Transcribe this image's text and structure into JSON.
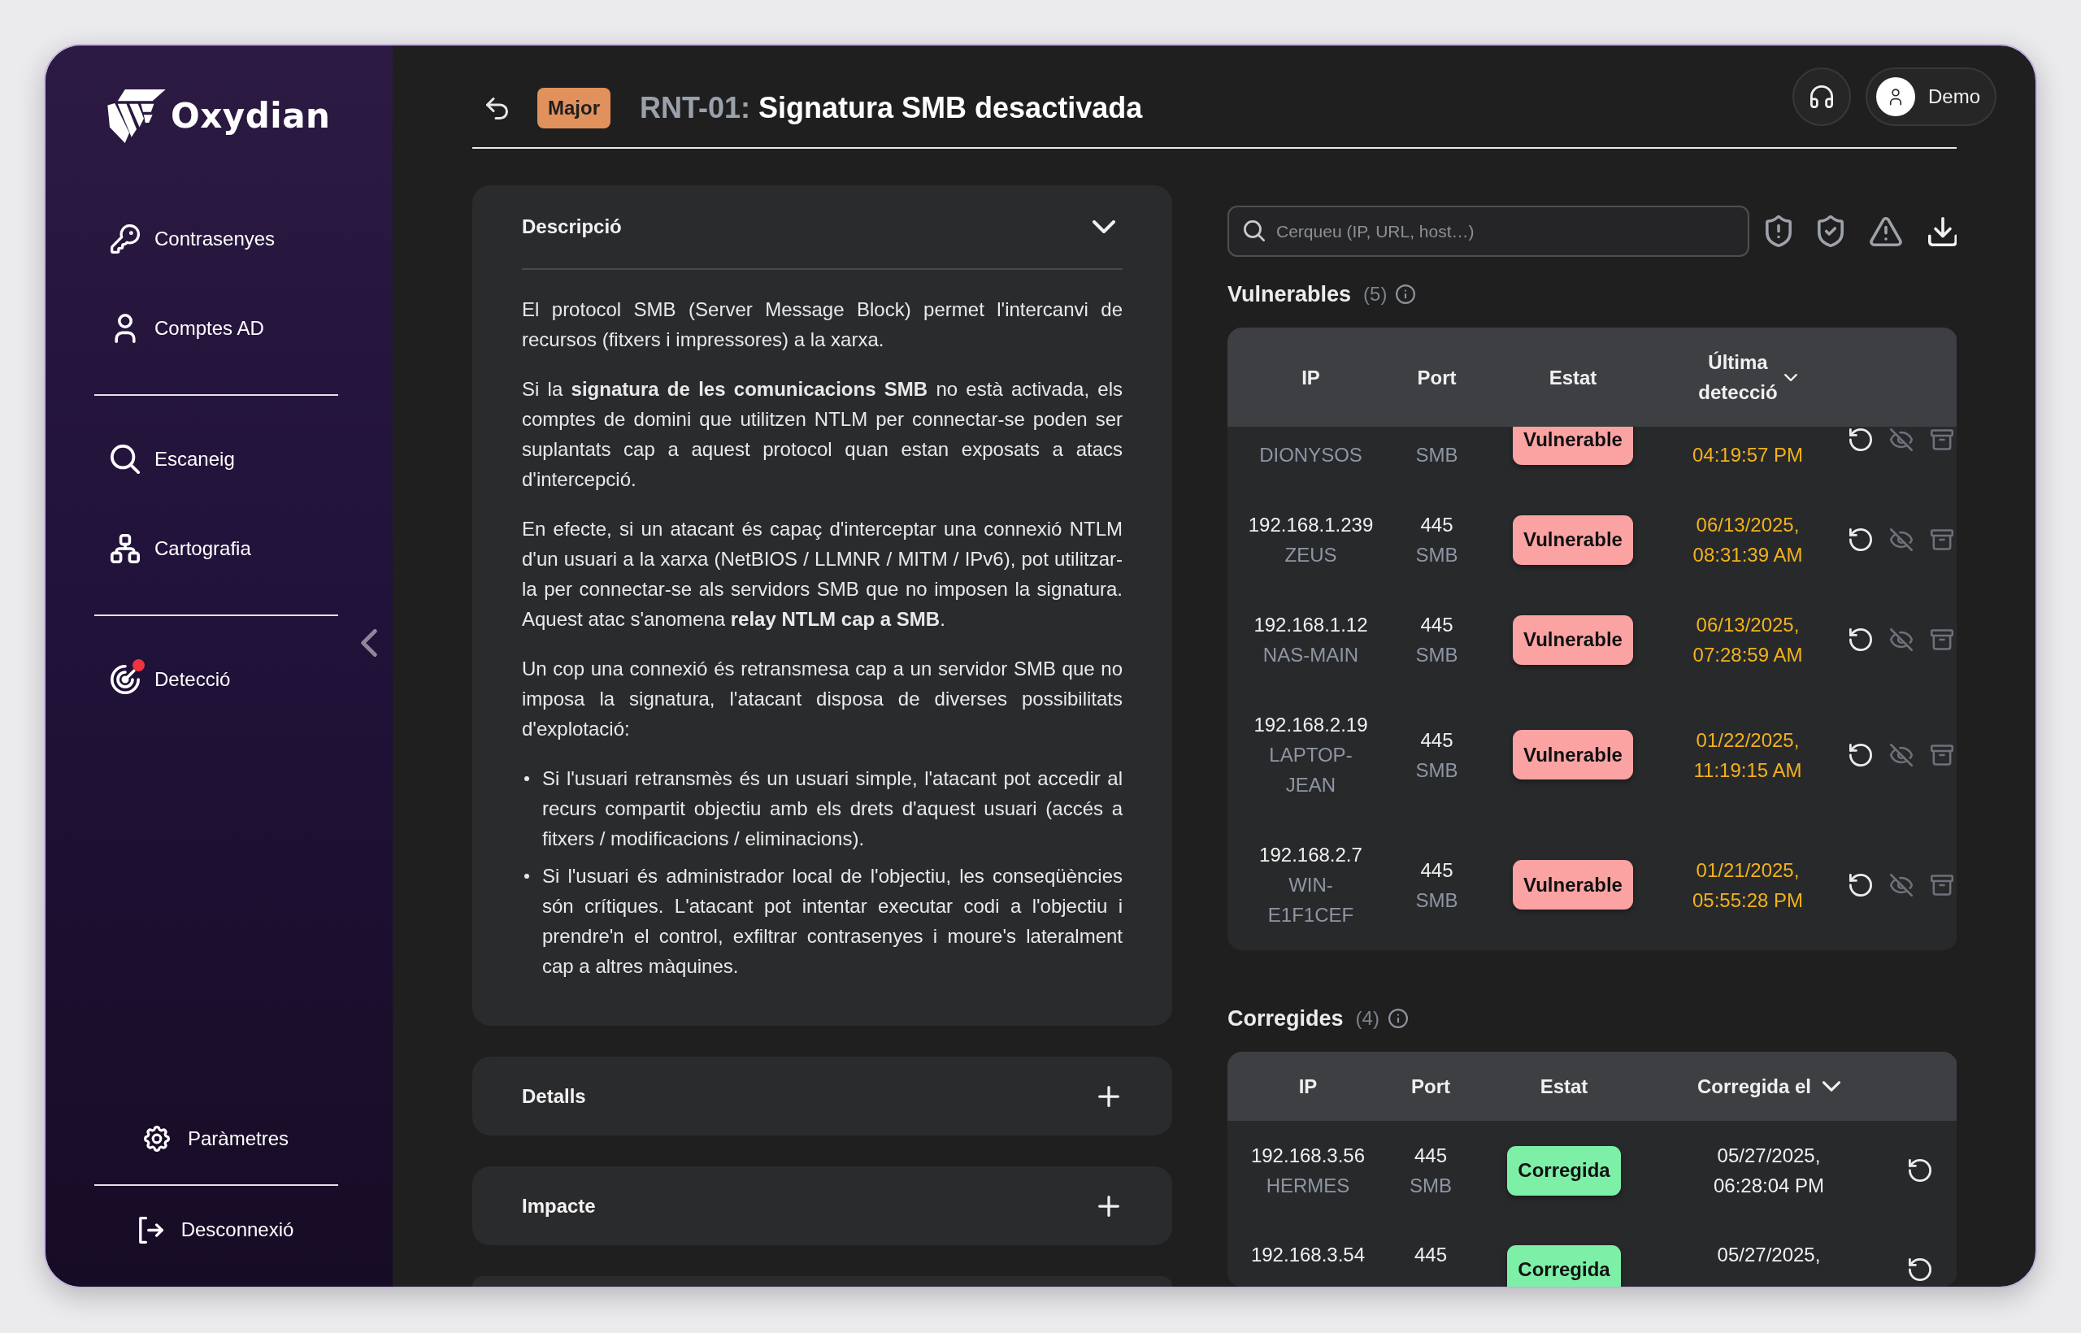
{
  "sidebar": {
    "logo": "Oxydian",
    "nav_groups": [
      {
        "items": [
          {
            "label": "Contrasenyes",
            "alert": false
          },
          {
            "label": "Comptes AD",
            "alert": false
          }
        ]
      },
      {
        "items": [
          {
            "label": "Escaneig",
            "alert": false
          },
          {
            "label": "Cartografia",
            "alert": false
          }
        ]
      },
      {
        "items": [
          {
            "label": "Detecció",
            "alert": true
          }
        ]
      }
    ],
    "footer_items": [
      {
        "label": "Paràmetres"
      },
      {
        "label": "Desconnexió"
      }
    ]
  },
  "header": {
    "severity": "Major",
    "code": "RNT-01:",
    "title": "Signatura SMB desactivada",
    "user": "Demo"
  },
  "sections": [
    {
      "title": "Descripció",
      "expanded": true,
      "paragraphs": [
        "El protocol SMB (Server Message Block) permet l'intercanvi de recursos (fitxers i impressores) a la xarxa.",
        "Si la **signatura de les comunicacions SMB** no està activada, els comptes de domini que utilitzen NTLM per connectar-se poden ser suplantats cap a aquest protocol quan estan exposats a atacs d'intercepció.",
        "En efecte, si un atacant és capaç d'interceptar una connexió NTLM d'un usuari a la xarxa (NetBIOS / LLMNR / MITM / IPv6), pot utilitzar-la per connectar-se als servidors SMB que no imposen la signatura. Aquest atac s'anomena **relay NTLM cap a SMB**.",
        "Un cop una connexió és retransmesa cap a un servidor SMB que no imposa la signatura, l'atacant disposa de diverses possibilitats d'explotació:"
      ],
      "list_items": [
        "Si l'usuari retransmès és un usuari simple, l'atacant pot accedir al recurs compartit objectiu amb els drets d'aquest usuari (accés a fitxers / modificacions / eliminacions).",
        "Si l'usuari és administrador local de l'objectiu, les conseqüències són crítiques. L'atacant pot intentar executar codi a l'objectiu i prendre'n el control, exfiltrar contrasenyes i moure's lateralment cap a altres màquines."
      ]
    },
    {
      "title": "Detalls",
      "expanded": false
    },
    {
      "title": "Impacte",
      "expanded": false
    }
  ],
  "search": {
    "placeholder": "Cerqueu (IP, URL, host…)"
  },
  "tables": [
    {
      "kind": "open",
      "title": "Vulnerables",
      "count": "(5)",
      "columns": [
        {
          "label": "IP",
          "sorted": false
        },
        {
          "label": "Port",
          "sorted": false
        },
        {
          "label": "Estat",
          "sorted": false
        },
        {
          "label": "Última detecció",
          "sorted": true
        }
      ],
      "rows": [
        {
          "host": "DIONYSOS",
          "protocol": "SMB",
          "status": "Vulnerable",
          "time": "04:19:57 PM"
        },
        {
          "ip": "192.168.1.239",
          "host": "ZEUS",
          "port": "445",
          "protocol": "SMB",
          "status": "Vulnerable",
          "date": "06/13/2025,",
          "time": "08:31:39 AM"
        },
        {
          "ip": "192.168.1.12",
          "host": "NAS-MAIN",
          "port": "445",
          "protocol": "SMB",
          "status": "Vulnerable",
          "date": "06/13/2025,",
          "time": "07:28:59 AM"
        },
        {
          "ip": "192.168.2.19",
          "host": "LAPTOP-JEAN",
          "port": "445",
          "protocol": "SMB",
          "status": "Vulnerable",
          "date": "01/22/2025,",
          "time": "11:19:15 AM"
        },
        {
          "ip": "192.168.2.7",
          "host": "WIN-E1F1CEF",
          "port": "445",
          "protocol": "SMB",
          "status": "Vulnerable",
          "date": "01/21/2025,",
          "time": "05:55:28 PM"
        }
      ]
    },
    {
      "kind": "fixed",
      "title": "Corregides",
      "count": "(4)",
      "columns": [
        {
          "label": "IP",
          "sorted": false
        },
        {
          "label": "Port",
          "sorted": false
        },
        {
          "label": "Estat",
          "sorted": false
        },
        {
          "label": "Corregida el",
          "sorted": true
        }
      ],
      "rows": [
        {
          "ip": "192.168.3.56",
          "host": "HERMES",
          "port": "445",
          "protocol": "SMB",
          "status": "Corregida",
          "date": "05/27/2025,",
          "time": "06:28:04 PM"
        },
        {
          "ip": "192.168.3.54",
          "port": "445",
          "status": "Corregida",
          "date": "05/27/2025,"
        }
      ]
    }
  ]
}
